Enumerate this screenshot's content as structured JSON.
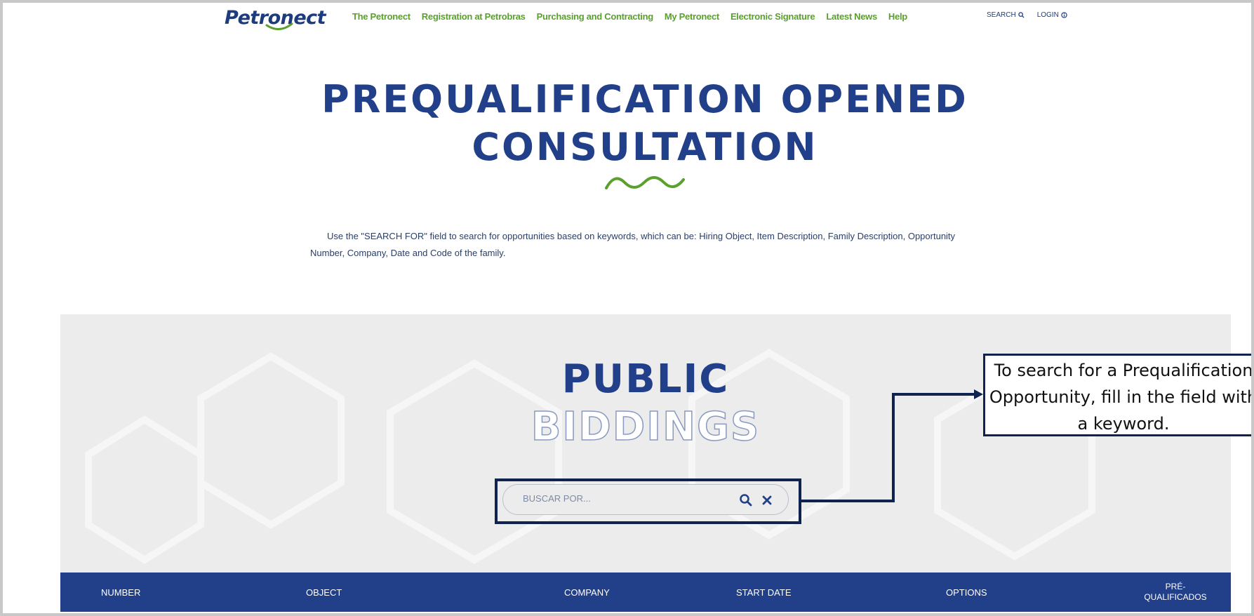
{
  "header": {
    "logo_text": "Petronect",
    "nav": [
      "The Petronect",
      "Registration at Petrobras",
      "Purchasing and Contracting",
      "My Petronect",
      "Electronic Signature",
      "Latest News",
      "Help"
    ],
    "search_label": "SEARCH",
    "login_label": "LOGIN"
  },
  "hero": {
    "title_line1": "PREQUALIFICATION OPENED",
    "title_line2": "CONSULTATION",
    "intro": "Use the \"SEARCH FOR\" field to search for opportunities based on keywords, which can be: Hiring Object, Item Description, Family Description, Opportunity Number, Company, Date and Code of the family."
  },
  "search_section": {
    "title_line1": "PUBLIC",
    "title_line2": "BIDDINGS",
    "search_placeholder": "BUSCAR POR...",
    "search_value": ""
  },
  "table": {
    "columns": [
      "NUMBER",
      "OBJECT",
      "COMPANY",
      "START DATE",
      "OPTIONS",
      "PRÉ-\nQUALIFICADOS"
    ],
    "last_column_line1": "PRÉ-",
    "last_column_line2": "QUALIFICADOS"
  },
  "annotation": {
    "line1": "To search for a Prequalification",
    "line2": "Opportunity, fill in the field with",
    "line3": "a keyword."
  },
  "colors": {
    "brand_navy": "#22408a",
    "brand_green": "#5aa02c",
    "annotation_border": "#0e2350"
  },
  "icons": [
    "search-icon",
    "info-icon",
    "magnifier-icon",
    "close-icon"
  ]
}
